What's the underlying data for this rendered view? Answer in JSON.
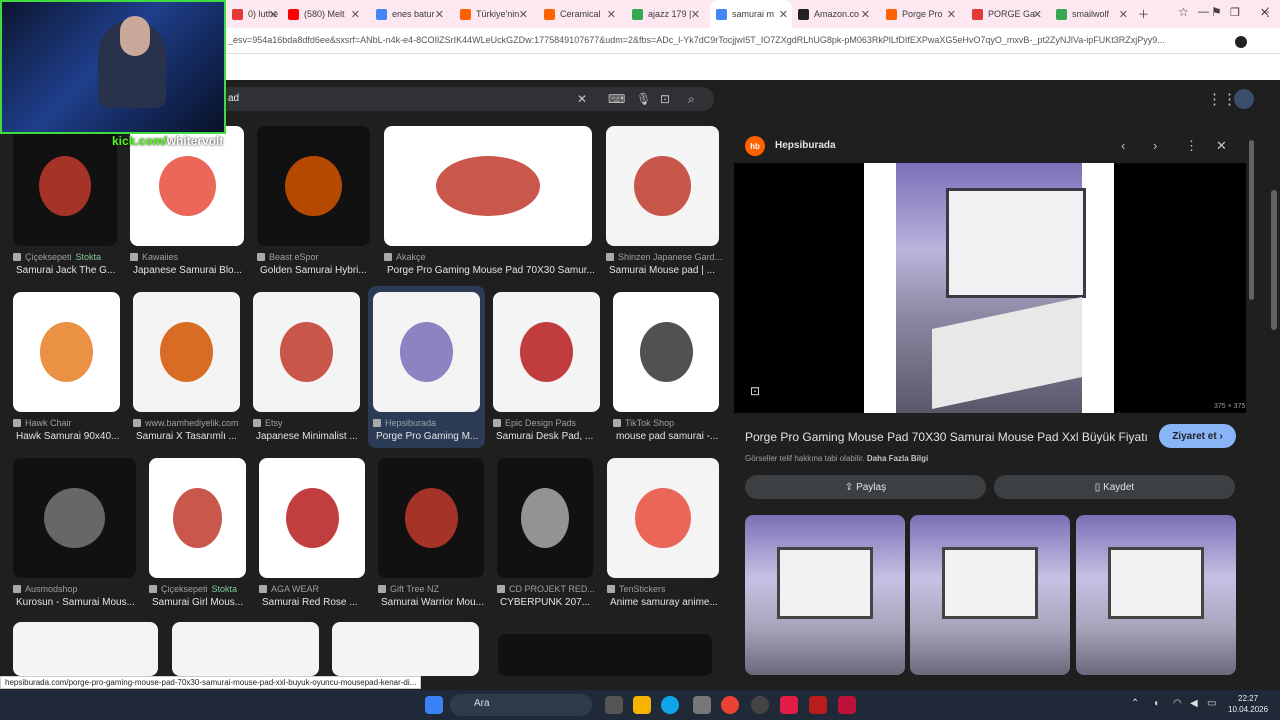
{
  "tabs": [
    {
      "label": "0) luthe",
      "color": "#e53935"
    },
    {
      "label": "(580) Melt",
      "color": "#ff0000"
    },
    {
      "label": "enes batur",
      "color": "#4285f4"
    },
    {
      "label": "Türkiye'nin",
      "color": "#ff6000"
    },
    {
      "label": "Ceramical",
      "color": "#ff6000"
    },
    {
      "label": "ajazz 179 |",
      "color": "#34a853"
    },
    {
      "label": "samurai m",
      "color": "#4285f4"
    },
    {
      "label": "Amazon.co",
      "color": "#222222"
    },
    {
      "label": "Porge Pro",
      "color": "#ff6000"
    },
    {
      "label": "PORGE Ga",
      "color": "#e53935"
    },
    {
      "label": "smailwolf",
      "color": "#34a853"
    }
  ],
  "address": {
    "url": "_esv=954a16bda8dfd6ee&sxsrf=ANbL-n4k-e4-8COIlZSrIK44WLeUckGZDw:1775849107677&udm=2&fbs=ADc_l-Yk7dC9rTocjjwI5T_IO7ZXgdRLhUG8pk-pM063RkPlLfDIfEXPwaXG5eHvO7qyO_mxvB-_pt2ZyNJlVa-ipFUKt3RZxjPyy9..."
  },
  "search": {
    "query": "ad"
  },
  "stream": {
    "handle": "whitervolt",
    "prefix": "kick.com/"
  },
  "results": [
    {
      "src": "Çiçeksepeti",
      "stock": "Stokta",
      "title": "Samurai Jack The G..."
    },
    {
      "src": "Kawaiies",
      "stock": "",
      "title": "Japanese Samurai Blo..."
    },
    {
      "src": "Beast eSpor",
      "stock": "",
      "title": "Golden Samurai Hybri..."
    },
    {
      "src": "Akakçe",
      "stock": "",
      "title": "Porge Pro Gaming Mouse Pad 70X30 Samur..."
    },
    {
      "src": "Shinzen Japanese Gard...",
      "stock": "",
      "title": "Samurai Mouse pad | ..."
    },
    {
      "src": "Hawk Chair",
      "stock": "",
      "title": "Hawk Samurai 90x40..."
    },
    {
      "src": "www.bamhediyelik.com",
      "stock": "",
      "title": "Samurai X Tasarımlı ..."
    },
    {
      "src": "Etsy",
      "stock": "",
      "title": "Japanese Minimalist ..."
    },
    {
      "src": "Hepsiburada",
      "stock": "",
      "title": "Porge Pro Gaming M..."
    },
    {
      "src": "Epic Design Pads",
      "stock": "",
      "title": "Samurai Desk Pad, ..."
    },
    {
      "src": "TikTok Shop",
      "stock": "",
      "title": "mouse pad samurai -..."
    },
    {
      "src": "Ausmodshop",
      "stock": "",
      "title": "Kurosun - Samurai Mous..."
    },
    {
      "src": "Çiçeksepeti",
      "stock": "Stokta",
      "title": "Samurai Girl Mous..."
    },
    {
      "src": "AGA WEAR",
      "stock": "",
      "title": "Samurai Red Rose ..."
    },
    {
      "src": "Gift Tree NZ",
      "stock": "",
      "title": "Samurai Warrior Mou..."
    },
    {
      "src": "CD PROJEKT RED...",
      "stock": "",
      "title": "CYBERPUNK 207..."
    },
    {
      "src": "TenStickers",
      "stock": "",
      "title": "Anime samuray anime..."
    }
  ],
  "panel": {
    "source": "Hepsiburada",
    "logo": "hb",
    "title": "Porge Pro Gaming Mouse Pad 70X30 Samurai Mouse Pad Xxl Büyük Fiyatı",
    "visit": "Ziyaret et",
    "copyright": "Görseller telif hakkına tabi olabilir.",
    "more": "Daha Fazla Bilgi",
    "share": "Paylaş",
    "save": "Kaydet",
    "dims": "375 × 375"
  },
  "status": {
    "url": "hepsiburada.com/porge-pro-gaming-mouse-pad-70x30-samurai-mouse-pad-xxl-buyuk-oyuncu-mousepad-kenar-di..."
  },
  "taskbar": {
    "search": "Ara",
    "time": "22:27",
    "date": "10.04.2026"
  },
  "colors": {
    "accent": "#8ab4f8",
    "kick": "#53fc18",
    "brand": "#ff6000"
  }
}
